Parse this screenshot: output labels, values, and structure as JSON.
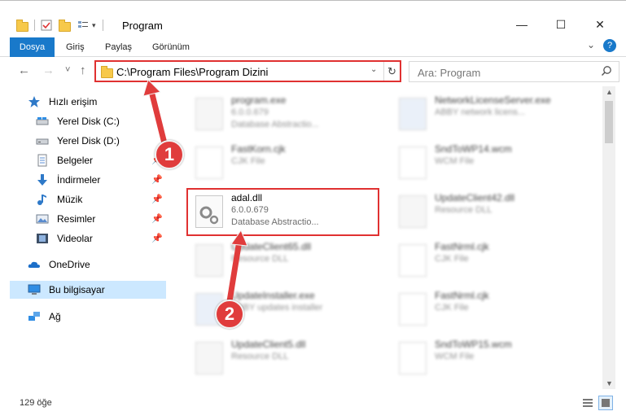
{
  "window": {
    "title": "Program",
    "minimize": "—",
    "maximize": "☐",
    "close": "✕",
    "help": "?"
  },
  "ribbon": {
    "tabs": [
      "Dosya",
      "Giriş",
      "Paylaş",
      "Görünüm"
    ],
    "expand": "⌄"
  },
  "nav": {
    "back": "←",
    "forward": "→",
    "recent": "˅",
    "up": "↑",
    "address": "C:\\Program Files\\Program Dizini",
    "address_dropdown": "⌄",
    "refresh": "↻",
    "search_placeholder": "Ara: Program"
  },
  "sidebar": {
    "items": [
      {
        "label": "Hızlı erişim",
        "icon": "star-icon",
        "pinned": false
      },
      {
        "label": "Yerel Disk (C:)",
        "icon": "drive-icon",
        "pinned": true
      },
      {
        "label": "Yerel Disk (D:)",
        "icon": "drive-icon",
        "pinned": true
      },
      {
        "label": "Belgeler",
        "icon": "documents-icon",
        "pinned": true
      },
      {
        "label": "İndirmeler",
        "icon": "download-icon",
        "pinned": true
      },
      {
        "label": "Müzik",
        "icon": "music-icon",
        "pinned": true
      },
      {
        "label": "Resimler",
        "icon": "pictures-icon",
        "pinned": true
      },
      {
        "label": "Videolar",
        "icon": "videos-icon",
        "pinned": true
      },
      {
        "label": "OneDrive",
        "icon": "cloud-icon",
        "pinned": false
      },
      {
        "label": "Bu bilgisayar",
        "icon": "computer-icon",
        "pinned": false
      },
      {
        "label": "Ağ",
        "icon": "network-icon",
        "pinned": false
      }
    ]
  },
  "files": [
    {
      "name": "program.exe",
      "line2": "6.0.0.679",
      "line3": "Database Abstractio...",
      "highlighted": false
    },
    {
      "name": "NetworkLicenseServer.exe",
      "line2": "ABBY network licens...",
      "line3": "",
      "highlighted": false
    },
    {
      "name": "FastKorn.cjk",
      "line2": "CJK File",
      "line3": "",
      "highlighted": false
    },
    {
      "name": "SndToWP14.wcm",
      "line2": "WCM File",
      "line3": "",
      "highlighted": false
    },
    {
      "name": "adal.dll",
      "line2": "6.0.0.679",
      "line3": "Database Abstractio...",
      "highlighted": true
    },
    {
      "name": "UpdateClient42.dll",
      "line2": "Resource DLL",
      "line3": "",
      "highlighted": false
    },
    {
      "name": "UpdateClient65.dll",
      "line2": "Resource DLL",
      "line3": "",
      "highlighted": false
    },
    {
      "name": "FastNrml.cjk",
      "line2": "CJK File",
      "line3": "",
      "highlighted": false
    },
    {
      "name": "UpdateInstaller.exe",
      "line2": "ABBY updates installer",
      "line3": "",
      "highlighted": false
    },
    {
      "name": "FastNrml.cjk",
      "line2": "CJK File",
      "line3": "",
      "highlighted": false
    },
    {
      "name": "UpdateClient5.dll",
      "line2": "Resource DLL",
      "line3": "",
      "highlighted": false
    },
    {
      "name": "SndToWP15.wcm",
      "line2": "WCM File",
      "line3": "",
      "highlighted": false
    }
  ],
  "status": {
    "item_count": "129 öğe"
  },
  "annotations": {
    "step1": "1",
    "step2": "2"
  },
  "colors": {
    "highlight": "#e03131",
    "badge": "#e03c3c",
    "ribbon_active": "#1979ca",
    "selected": "#cce8ff"
  }
}
